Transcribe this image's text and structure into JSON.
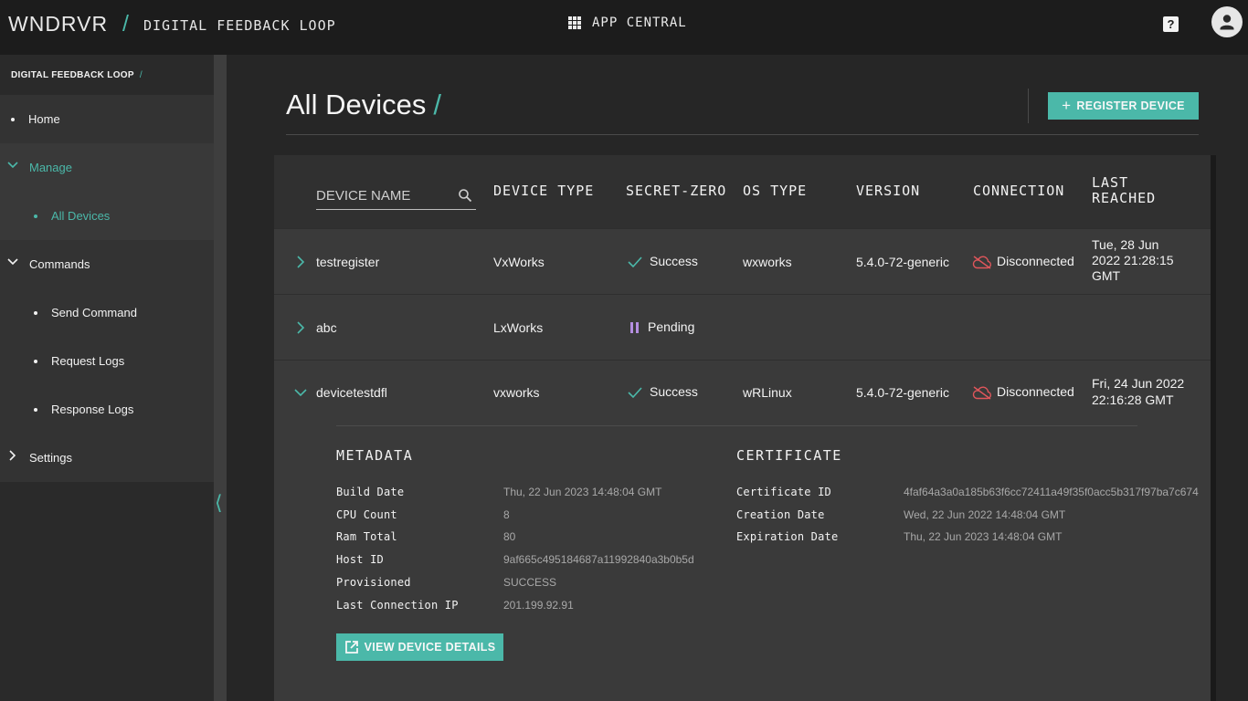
{
  "header": {
    "brand": "WNDRVR",
    "app_name": "DIGITAL FEEDBACK LOOP",
    "app_central": "APP CENTRAL",
    "help_glyph": "?"
  },
  "sidebar": {
    "breadcrumb": "DIGITAL FEEDBACK LOOP",
    "items": {
      "home": "Home",
      "manage": "Manage",
      "all_devices": "All Devices",
      "commands": "Commands",
      "send_command": "Send Command",
      "request_logs": "Request Logs",
      "response_logs": "Response Logs",
      "settings": "Settings"
    }
  },
  "page": {
    "title": "All Devices",
    "register_label": "REGISTER DEVICE"
  },
  "table": {
    "search_placeholder": "DEVICE NAME",
    "columns": {
      "device_type": "DEVICE TYPE",
      "secret_zero": "SECRET-ZERO",
      "os_type": "OS TYPE",
      "version": "VERSION",
      "connection": "CONNECTION",
      "last_reached_1": "LAST",
      "last_reached_2": "REACHED"
    },
    "rows": [
      {
        "name": "testregister",
        "device_type": "VxWorks",
        "secret_zero": "Success",
        "os_type": "wxworks",
        "version": "5.4.0-72-generic",
        "connection": "Disconnected",
        "last_reached_1": "Tue, 28 Jun",
        "last_reached_2": "2022 21:28:15",
        "last_reached_3": "GMT"
      },
      {
        "name": "abc",
        "device_type": "LxWorks",
        "secret_zero": "Pending"
      },
      {
        "name": "devicetestdfl",
        "device_type": "vxworks",
        "secret_zero": "Success",
        "os_type": "wRLinux",
        "version": "5.4.0-72-generic",
        "connection": "Disconnected",
        "last_reached_1": "Fri, 24 Jun 2022",
        "last_reached_2": "22:16:28 GMT"
      }
    ],
    "expanded": {
      "metadata_title": "METADATA",
      "certificate_title": "CERTIFICATE",
      "metadata": {
        "build_date_label": "Build Date",
        "build_date": "Thu, 22 Jun 2023 14:48:04 GMT",
        "cpu_count_label": "CPU Count",
        "cpu_count": "8",
        "ram_total_label": "Ram Total",
        "ram_total": "80",
        "host_id_label": "Host ID",
        "host_id": "9af665c495184687a11992840a3b0b5d",
        "provisioned_label": "Provisioned",
        "provisioned": "SUCCESS",
        "last_ip_label": "Last Connection IP",
        "last_ip": "201.199.92.91"
      },
      "certificate": {
        "cert_id_label": "Certificate ID",
        "cert_id": "4faf64a3a0a185b63f6cc72411a49f35f0acc5b317f97ba7c674",
        "creation_label": "Creation Date",
        "creation": "Wed, 22 Jun 2022 14:48:04 GMT",
        "expiration_label": "Expiration Date",
        "expiration": "Thu, 22 Jun 2023 14:48:04 GMT"
      },
      "view_details_label": "VIEW DEVICE DETAILS"
    }
  },
  "colors": {
    "accent": "#4bb8a9",
    "error": "#e0565b",
    "pending": "#b48ee0"
  }
}
